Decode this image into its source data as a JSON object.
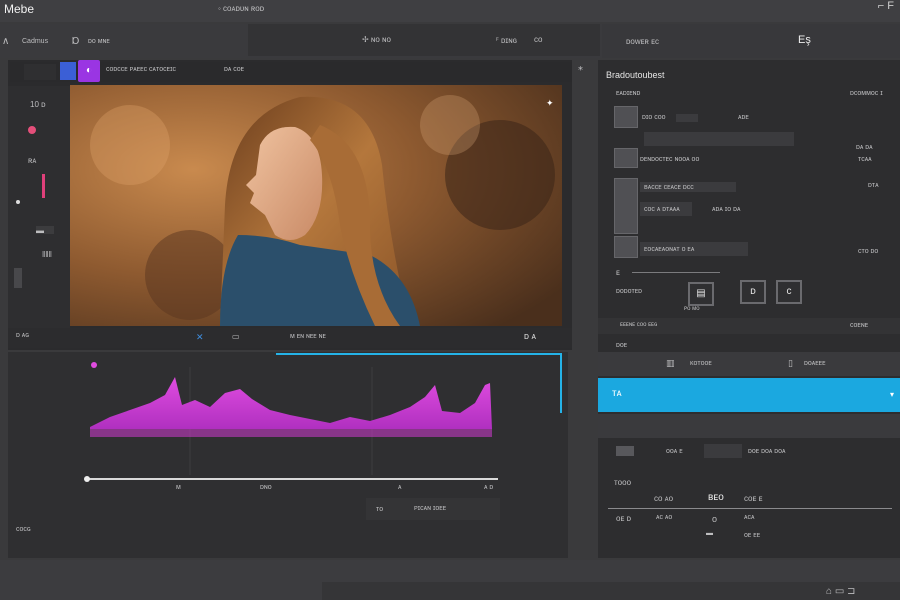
{
  "app": {
    "title": "Mebe",
    "doc_title": "◦ ᴄᴏᴀᴅᴜɴ ʀᴏᴅ",
    "window_controls": "⌐  F"
  },
  "toolbar": {
    "left_a": "∧",
    "left_b": "Cadmus",
    "left_c": "Ɒ",
    "left_d": "ᴅᴏ ᴍɴᴇ",
    "center_a": "✢ ɴᴏ ɴᴏ",
    "center_b": "ꟳ ᴅɪɴɢ",
    "center_c": "ᴄᴏ",
    "right_a": "ᴅᴏᴡᴇʀ ᴇᴄ",
    "right_b": "Eş"
  },
  "viewer": {
    "tab_label": "ᴄᴏᴅᴄᴄᴇ ᴘᴀᴇᴇᴄ ᴄᴀᴛᴏᴄᴇɪᴄ",
    "tab_label_2": "ᴅᴀ ᴄᴏᴇ",
    "corner_icon": "⁎",
    "photo_badge": "✦",
    "tool_labels": [
      "10 ᴅ",
      "ᴅ",
      "ʀᴀ",
      "▬",
      "ǁǁǁ",
      "ᴍ"
    ],
    "transport": {
      "left": "ᴅ ᴀɢ",
      "time": "ᴍ ᴇɴ ɴᴇᴇ ɴᴇ",
      "right": "ᴅ ᴀ"
    }
  },
  "waveform": {
    "x_ticks": [
      "ᴍ",
      "ᴅɴᴏ",
      "ᴀ",
      "ᴀ ᴅ"
    ],
    "footer_left": "ᴛᴏ",
    "footer_mid": "ᴘɪᴄᴀɴ ɪᴏᴇᴇ",
    "panel_label": "ᴄᴏᴄɢ",
    "accent_color": "#d640d6"
  },
  "right_panel": {
    "title": "Bradoutoubest",
    "sub_left": "ᴇᴀᴅɪᴇɴᴅ",
    "sub_right": "ᴅᴄᴏᴍᴍᴏᴄ ɪ",
    "rows": [
      {
        "label": "ᴅɪᴏ ᴄᴏᴏ",
        "value": "ᴛᴏ ᴄɪᴄ",
        "value2": "ᴀᴅᴇ",
        "meta": "ᴅᴀ ᴅᴀ"
      },
      {
        "label": "ᴅᴇɴᴅᴏᴄᴛᴇᴄ ɴᴏᴏᴀ ᴏᴏ",
        "value": "",
        "value2": "",
        "meta": "ᴛᴄᴀᴀ"
      },
      {
        "label": "ʙᴀᴄᴄᴇ ᴄᴇᴀᴄᴇ ᴅᴄᴄ",
        "value": "ᴄᴏᴄ ᴀ ᴅᴛᴀᴀᴀ",
        "value2": "ᴀᴅᴀ ɪᴏ ᴅᴀ",
        "meta": "ᴅᴛᴀ"
      },
      {
        "label": "ᴇᴏᴄᴀᴇᴀᴏɴᴀᴛ ᴏ ᴇᴀ",
        "value": "",
        "value2": "",
        "meta": "ᴄᴛᴏ ᴅᴏ"
      }
    ],
    "action_label": "ᴅᴏᴅᴏᴛᴇᴅ",
    "action_caption": "ᴘᴏ ᴍᴏ",
    "icon_btn_1": "ᴅ",
    "icon_btn_2": "ᴄ",
    "divider_text": "ᴇ",
    "section_left": "ᴇᴇᴇɴᴇ ᴄᴏᴏ ᴇᴇɢ",
    "section_right": "ᴄᴏᴇɴᴇ",
    "section2": "ᴅᴏᴇ",
    "section3_a": "ᴋᴏᴛᴏᴏᴇ",
    "section3_b": "ᴅᴏᴀᴇᴇᴇ",
    "blue_label": "ᴛᴀ",
    "sub_a": "ᴏᴏᴀ ᴇ",
    "sub_b": "ᴅᴏᴇ ᴅᴏᴀ ᴅᴏᴀ",
    "table": {
      "header_a": "ᴛᴏᴏᴏ",
      "row1": [
        "ᴄᴏ ᴀᴏ",
        "ʙᴇᴏ",
        "ᴄᴏᴇ ᴇ"
      ],
      "row2": [
        "ᴏᴇ ᴅ",
        "ᴀᴄ ᴀᴏ",
        "ᴏ",
        "ᴀᴄᴀ"
      ],
      "row3": [
        "▬",
        "ᴏᴇ ᴇᴇ"
      ]
    }
  },
  "bottom": {
    "icons": "⌂  ▭  ⊐"
  }
}
